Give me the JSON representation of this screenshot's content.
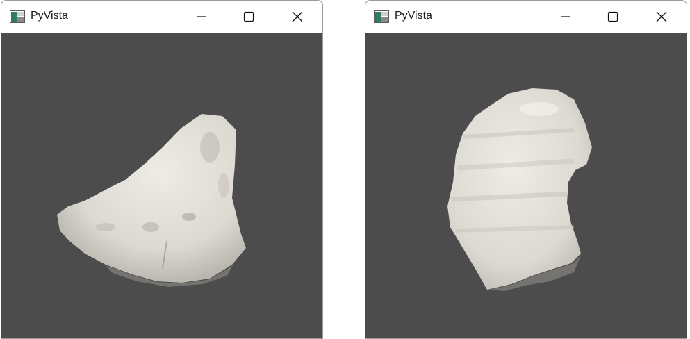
{
  "windows": [
    {
      "id": "left",
      "title": "PyVista",
      "controls": {
        "minimize": "minimize-icon",
        "maximize": "maximize-icon",
        "close": "close-icon"
      },
      "viewport_background": "#4c4c4c",
      "mesh_color": "#e8e6df"
    },
    {
      "id": "right",
      "title": "PyVista",
      "controls": {
        "minimize": "minimize-icon",
        "maximize": "maximize-icon",
        "close": "close-icon"
      },
      "viewport_background": "#4c4c4c",
      "mesh_color": "#e8e6df"
    }
  ]
}
